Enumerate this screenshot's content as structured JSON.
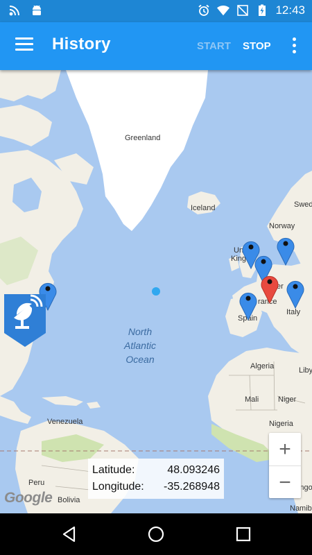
{
  "status_bar": {
    "time": "12:43",
    "icons": [
      "wifi-antenna-icon",
      "android-icon",
      "alarm-icon",
      "wifi-icon",
      "no-signal-icon",
      "battery-charging-icon"
    ]
  },
  "app_bar": {
    "title": "History",
    "start_label": "START",
    "stop_label": "STOP",
    "menu_icon": "hamburger-menu-icon",
    "overflow_icon": "overflow-menu-icon",
    "accent": "#2196f3",
    "disabled_color": "#8ec6f5"
  },
  "map": {
    "land_color": "#f2efe6",
    "water_color": "#a9c9f0",
    "labels": {
      "greenland": "Greenland",
      "iceland": "Iceland",
      "norway": "Norway",
      "sweden": "Swed",
      "uk": "Uni",
      "uk2": "King",
      "france": "rance",
      "germany": "er",
      "spain": "Spain",
      "italy": "Italy",
      "algeria": "Algeria",
      "libya": "Liby",
      "mali": "Mali",
      "niger": "Niger",
      "nigeria": "Nigeria",
      "venezuela": "Venezuela",
      "peru": "Peru",
      "bolivia": "Bolivia",
      "namibia": "Namib",
      "angola": "Ango",
      "ocean_line1": "North",
      "ocean_line2": "Atlantic",
      "ocean_line3": "Ocean"
    },
    "markers": [
      {
        "color": "blue",
        "name": "map-marker-usa"
      },
      {
        "color": "blue",
        "name": "map-marker-uk"
      },
      {
        "color": "blue",
        "name": "map-marker-netherlands"
      },
      {
        "color": "blue",
        "name": "map-marker-denmark"
      },
      {
        "color": "red",
        "name": "map-marker-switzerland-selected"
      },
      {
        "color": "blue",
        "name": "map-marker-spain"
      },
      {
        "color": "blue",
        "name": "map-marker-italy"
      }
    ],
    "marker_colors": {
      "blue": "#3a8be8",
      "red": "#e84a3f"
    },
    "zoom_in": "+",
    "zoom_out": "−",
    "attribution": "Google"
  },
  "coordinates": {
    "lat_label": "Latitude:",
    "lat_value": "48.093246",
    "lon_label": "Longitude:",
    "lon_value": "-35.268948"
  },
  "nav_bar": {
    "back": "back-icon",
    "home": "home-icon",
    "recents": "recents-icon"
  }
}
